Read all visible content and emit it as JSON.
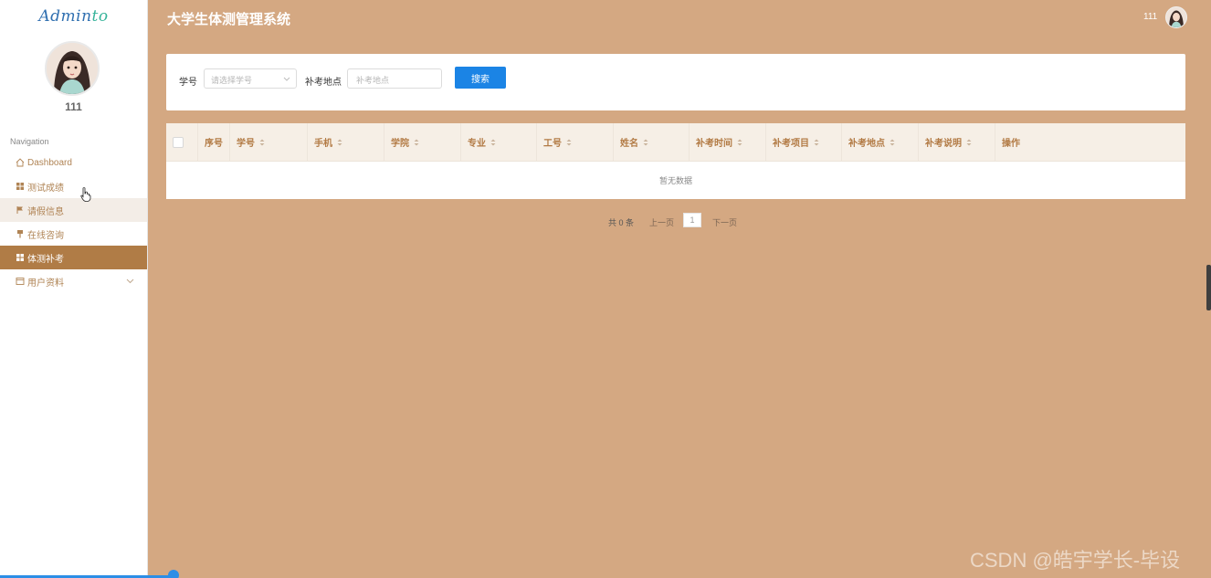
{
  "sidebar": {
    "brand": {
      "main": "Admin",
      "accent": "to"
    },
    "username": "111",
    "nav_title": "Navigation",
    "items": [
      {
        "label": "Dashboard",
        "icon": "home-icon"
      },
      {
        "label": "测试成绩",
        "icon": "grid-icon"
      },
      {
        "label": "请假信息",
        "icon": "flag-icon"
      },
      {
        "label": "在线咨询",
        "icon": "pin-icon"
      },
      {
        "label": "体测补考",
        "icon": "grid-icon",
        "active": true
      },
      {
        "label": "用户资料",
        "icon": "calendar-icon",
        "has_children": true
      }
    ]
  },
  "header": {
    "title": "大学生体测管理系统",
    "username": "111"
  },
  "search": {
    "student_id_label": "学号",
    "student_id_placeholder": "请选择学号",
    "location_label": "补考地点",
    "location_placeholder": "补考地点",
    "button_label": "搜索"
  },
  "table": {
    "columns": [
      "序号",
      "学号",
      "手机",
      "学院",
      "专业",
      "工号",
      "姓名",
      "补考时间",
      "补考项目",
      "补考地点",
      "补考说明",
      "操作"
    ],
    "empty_text": "暂无数据"
  },
  "pagination": {
    "total_text": "共 0 条",
    "prev": "上一页",
    "current_page": "1",
    "next": "下一页"
  },
  "watermark": "CSDN @皓宇学长-毕设",
  "colors": {
    "main_bg": "#d4a882",
    "sidebar_active": "#b07c46",
    "table_header_bg": "#f6efe6",
    "accent_text": "#b27a44",
    "primary_button": "#1b84e5"
  }
}
